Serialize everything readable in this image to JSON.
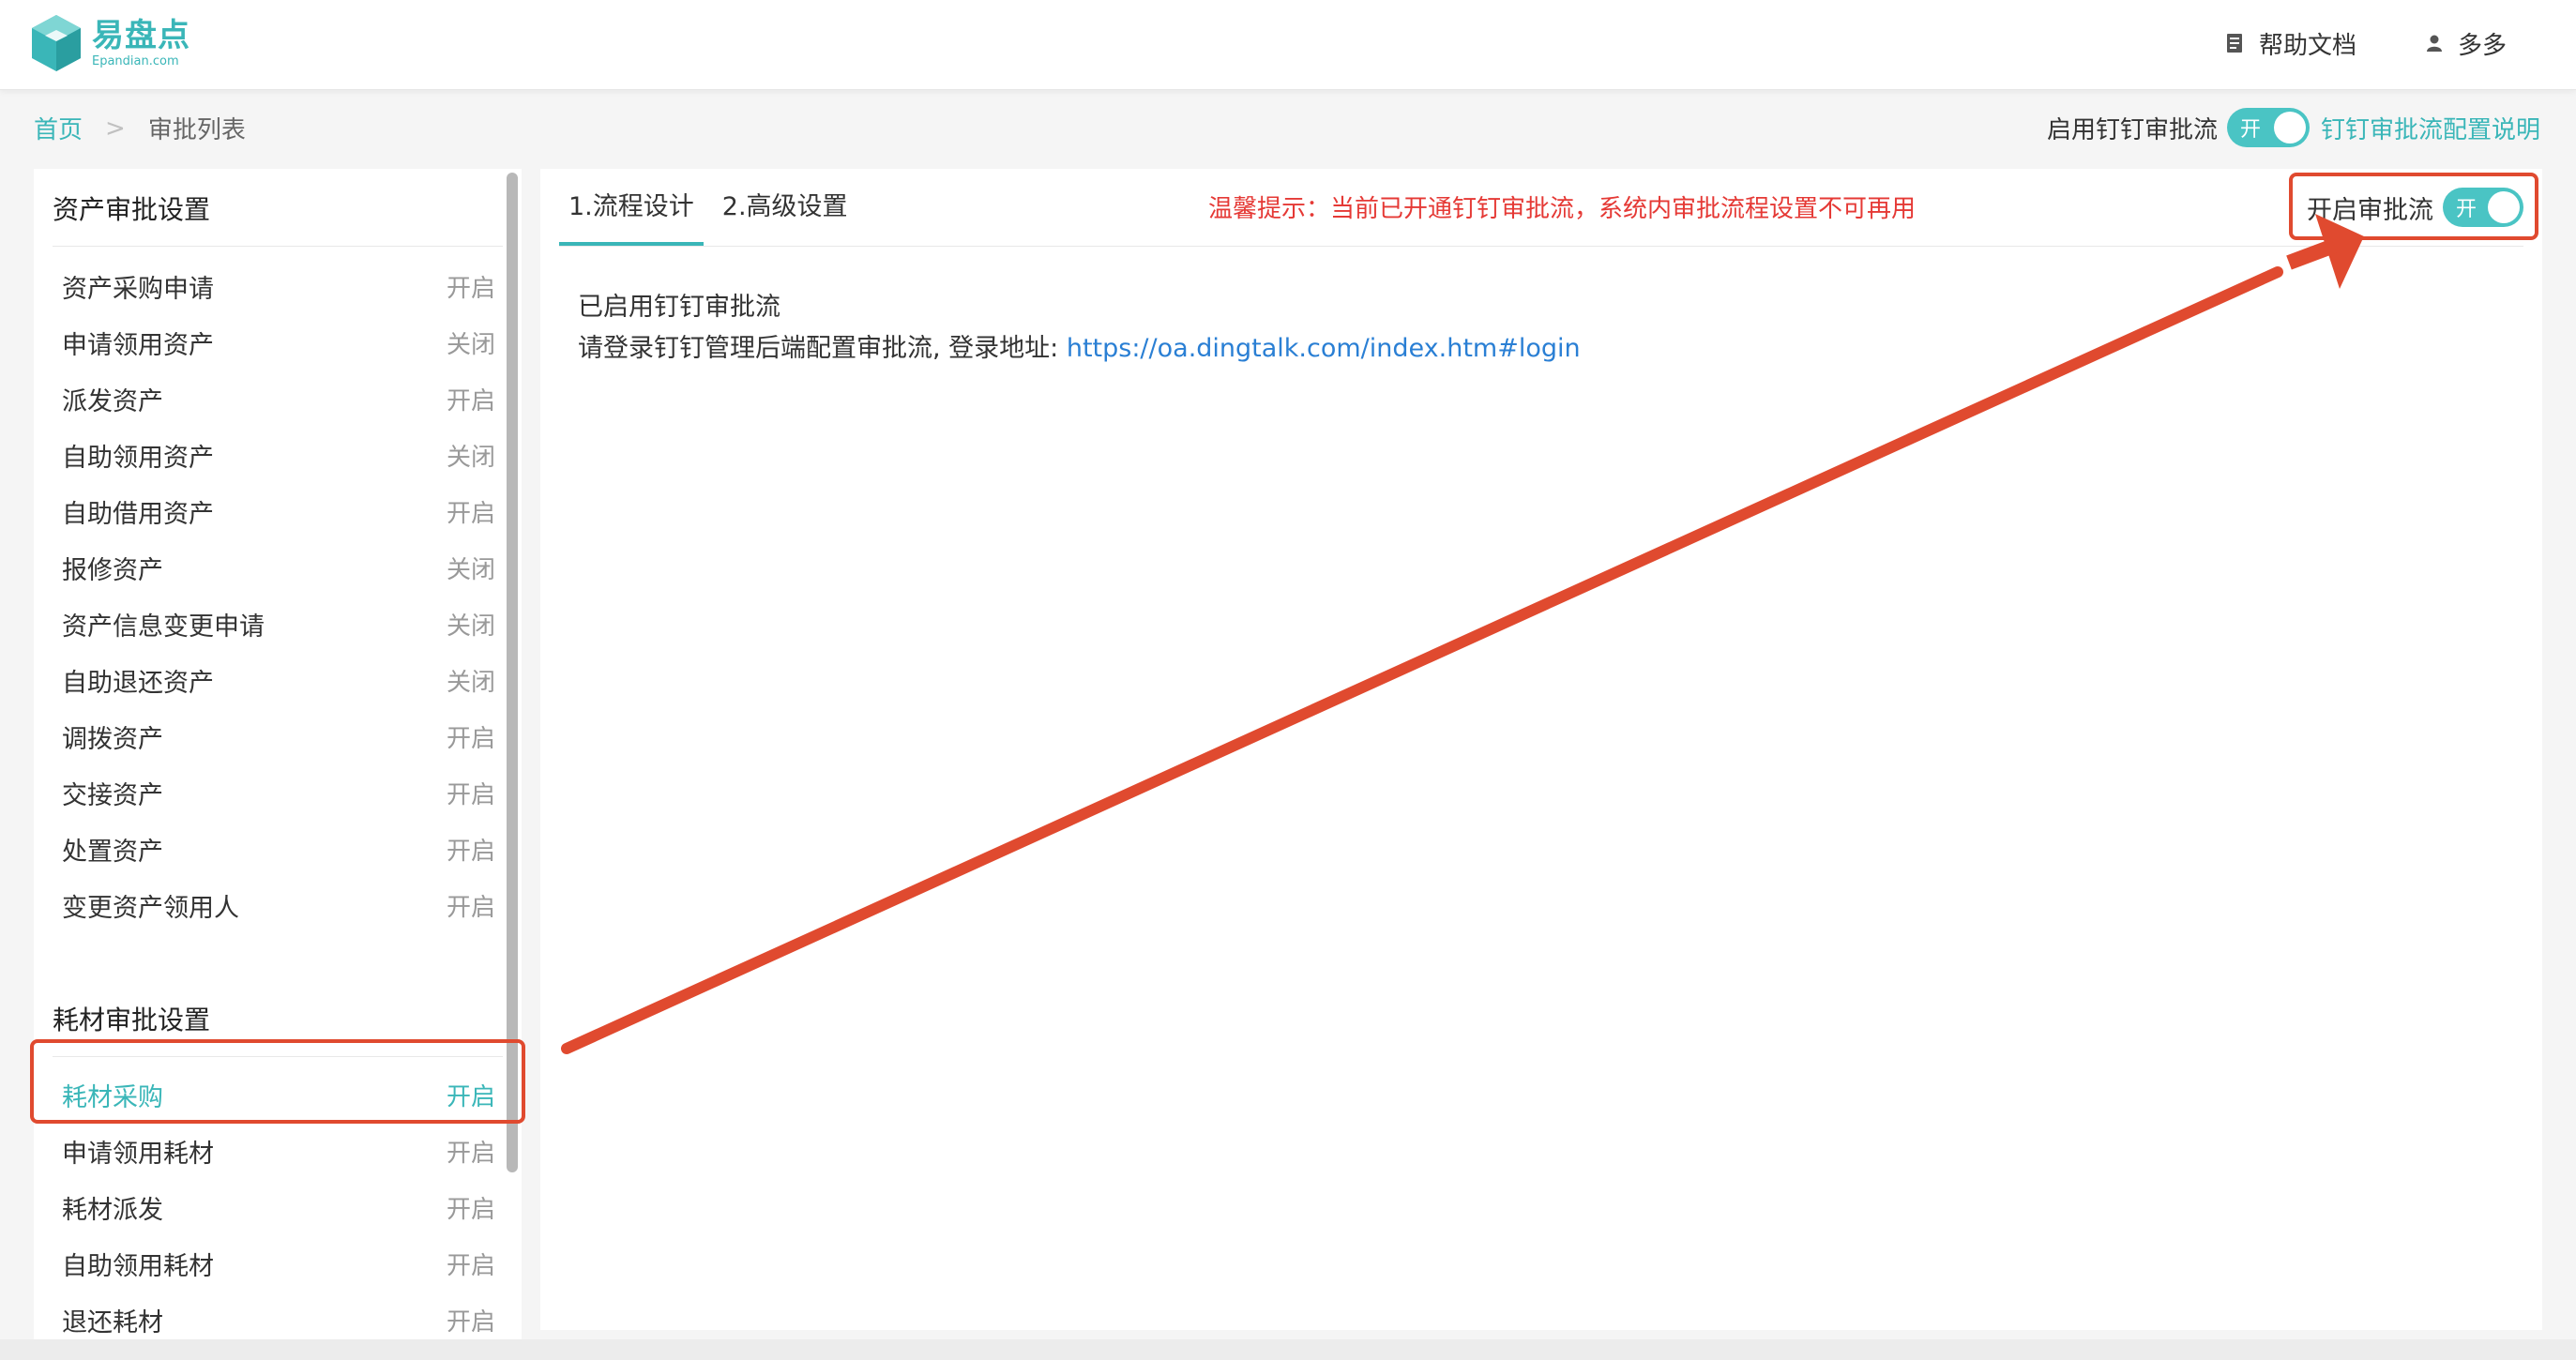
{
  "header": {
    "logo_cn": "易盘点",
    "logo_en": "Epandian.com",
    "help_label": "帮助文档",
    "user_name": "多多"
  },
  "breadcrumb": {
    "home": "首页",
    "separator": ">",
    "current": "审批列表"
  },
  "subbar": {
    "dingtalk_label": "启用钉钉审批流",
    "dingtalk_toggle_text": "开",
    "dingtalk_toggle_on": true,
    "doc_link": "钉钉审批流配置说明"
  },
  "sidebar": {
    "asset_section_title": "资产审批设置",
    "asset_items": [
      {
        "name": "资产采购申请",
        "state": "开启"
      },
      {
        "name": "申请领用资产",
        "state": "关闭"
      },
      {
        "name": "派发资产",
        "state": "开启"
      },
      {
        "name": "自助领用资产",
        "state": "关闭"
      },
      {
        "name": "自助借用资产",
        "state": "开启"
      },
      {
        "name": "报修资产",
        "state": "关闭"
      },
      {
        "name": "资产信息变更申请",
        "state": "关闭"
      },
      {
        "name": "自助退还资产",
        "state": "关闭"
      },
      {
        "name": "调拨资产",
        "state": "开启"
      },
      {
        "name": "交接资产",
        "state": "开启"
      },
      {
        "name": "处置资产",
        "state": "开启"
      },
      {
        "name": "变更资产领用人",
        "state": "开启"
      }
    ],
    "consumable_section_title": "耗材审批设置",
    "consumable_items": [
      {
        "name": "耗材采购",
        "state": "开启",
        "active": true
      },
      {
        "name": "申请领用耗材",
        "state": "开启"
      },
      {
        "name": "耗材派发",
        "state": "开启"
      },
      {
        "name": "自助领用耗材",
        "state": "开启"
      },
      {
        "name": "退还耗材",
        "state": "开启"
      }
    ]
  },
  "main": {
    "tabs": [
      {
        "label": "1.流程设计",
        "active": true
      },
      {
        "label": "2.高级设置",
        "active": false
      }
    ],
    "warning": "温馨提示：当前已开通钉钉审批流，系统内审批流程设置不可再用",
    "switch_label": "开启审批流",
    "switch_toggle_text": "开",
    "switch_on": true,
    "content_line1": "已启用钉钉审批流",
    "content_line2_prefix": "请登录钉钉管理后端配置审批流, 登录地址: ",
    "content_link": "https://oa.dingtalk.com/index.htm#login"
  },
  "colors": {
    "accent": "#3ab6b8",
    "toggle_on": "#4ac4c4",
    "warning": "#e53935",
    "annotation": "#e04a2f",
    "link": "#2a7fd4"
  }
}
